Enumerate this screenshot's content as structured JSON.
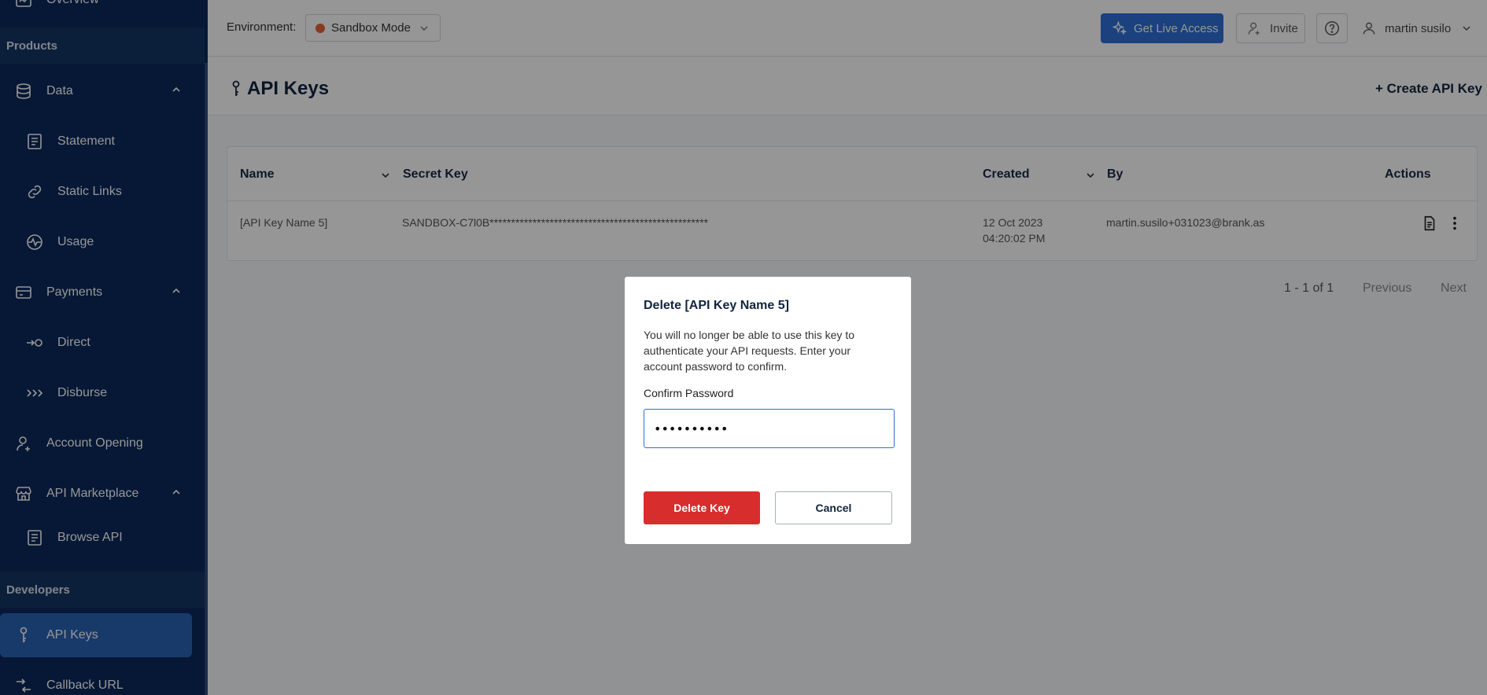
{
  "sidebar": {
    "top_item": "Overview",
    "products_header": "Products",
    "data": {
      "label": "Data",
      "children": [
        "Statement",
        "Static Links",
        "Usage"
      ]
    },
    "payments": {
      "label": "Payments",
      "children": [
        "Direct",
        "Disburse"
      ]
    },
    "account_opening": "Account Opening",
    "api_marketplace": {
      "label": "API Marketplace",
      "children": [
        "Browse API"
      ]
    },
    "developers_header": "Developers",
    "api_keys": "API Keys",
    "callback_url": "Callback URL"
  },
  "topbar": {
    "environment_label": "Environment:",
    "environment_value": "Sandbox Mode",
    "get_live_access": "Get Live Access",
    "invite": "Invite",
    "user_name": "martin susilo"
  },
  "page": {
    "title": "API Keys",
    "create_button": "+ Create API Key"
  },
  "table": {
    "headers": {
      "name": "Name",
      "secret_key": "Secret Key",
      "created": "Created",
      "by": "By",
      "actions": "Actions"
    },
    "rows": [
      {
        "name": "[API Key Name 5]",
        "secret_key": "SANDBOX-C7l0B***************************************************",
        "created_date": "12 Oct 2023",
        "created_time": "04:20:02 PM",
        "by": "martin.susilo+031023@brank.as"
      }
    ]
  },
  "pagination": {
    "summary": "1 - 1 of 1",
    "previous": "Previous",
    "next": "Next"
  },
  "modal": {
    "title": "Delete [API Key Name 5]",
    "message": "You will no longer be able to use this key to authenticate your API requests. Enter your account password to confirm.",
    "password_label": "Confirm Password",
    "password_value": "••••••••••",
    "delete_button": "Delete Key",
    "cancel_button": "Cancel"
  },
  "colors": {
    "sidebar_bg": "#0b2a5c",
    "active_item": "#2a64b4",
    "primary_button": "#2f6fd6",
    "danger_button": "#d82d2d",
    "sandbox_dot": "#e8613a"
  }
}
